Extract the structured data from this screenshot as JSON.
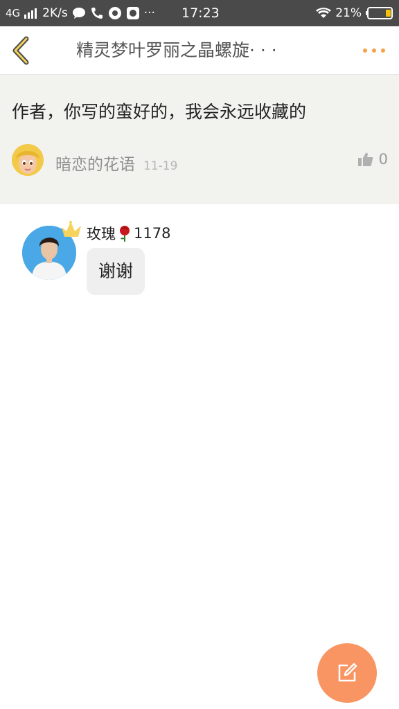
{
  "status_bar": {
    "network": "4G",
    "speed": "2K/s",
    "time": "17:23",
    "battery": "21%",
    "dots": "···",
    "icons": [
      "signal-icon",
      "chat-bubble-icon",
      "phone-call-icon",
      "app-icon",
      "camera-app-icon",
      "wifi-icon",
      "battery-icon"
    ]
  },
  "header": {
    "title": "精灵梦叶罗丽之晶螺旋· · ·",
    "back_icon": "chevron-left-icon",
    "more_icon": "more-dots-icon",
    "accent_color": "#f5a24d"
  },
  "comment": {
    "text": "作者，你写的蛮好的，我会永远收藏的",
    "author": "暗恋的花语",
    "date": "11-19",
    "likes": "0",
    "like_icon": "thumbs-up-icon"
  },
  "reply": {
    "name": "玫瑰",
    "badge_icon": "rose-icon",
    "level": "1178",
    "message": "谢谢",
    "crown_icon": "crown-icon"
  },
  "fab": {
    "icon": "edit-icon",
    "color": "#f99463"
  }
}
